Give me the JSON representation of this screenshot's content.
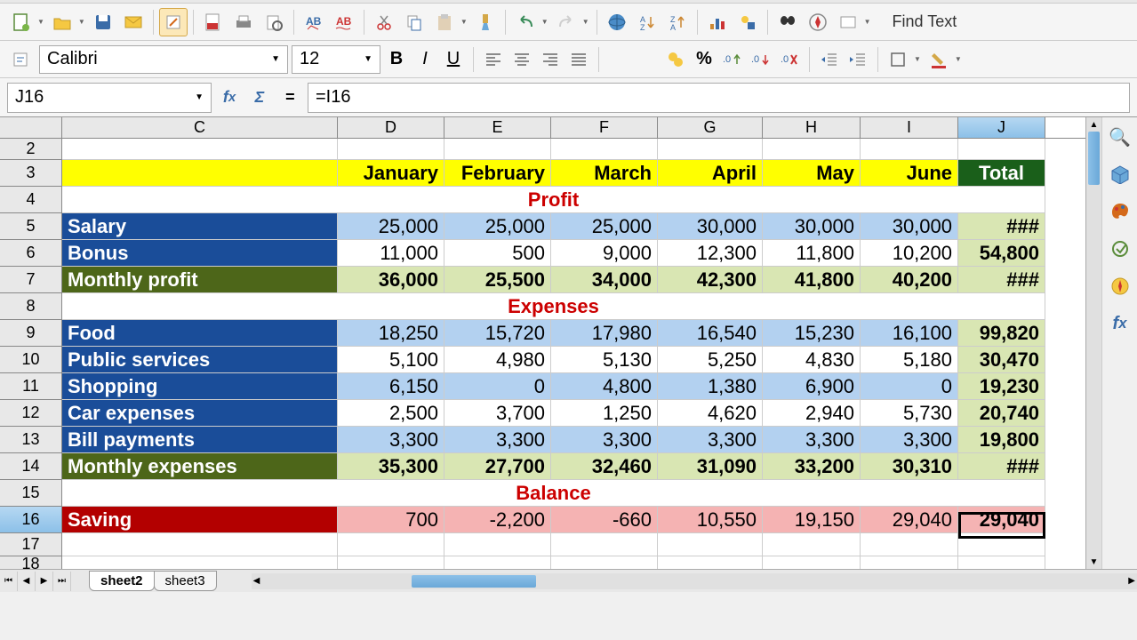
{
  "toolbar": {
    "find_label": "Find Text"
  },
  "format": {
    "font": "Calibri",
    "size": "12"
  },
  "formula": {
    "cell_ref": "J16",
    "value": "=I16"
  },
  "columns": [
    "C",
    "D",
    "E",
    "F",
    "G",
    "H",
    "I",
    "J"
  ],
  "col_widths": {
    "C": 310,
    "D": 120,
    "E": 120,
    "F": 120,
    "G": 118,
    "H": 110,
    "I": 110,
    "J": 98
  },
  "rows_visible": [
    2,
    3,
    4,
    5,
    6,
    7,
    8,
    9,
    10,
    11,
    12,
    13,
    14,
    15,
    16,
    17,
    18
  ],
  "header_row": {
    "months": [
      "January",
      "February",
      "March",
      "April",
      "May",
      "June"
    ],
    "total": "Total"
  },
  "sections": {
    "profit": "Profit",
    "expenses": "Expenses",
    "balance": "Balance"
  },
  "data": {
    "salary": {
      "label": "Salary",
      "vals": [
        "25,000",
        "25,000",
        "25,000",
        "30,000",
        "30,000",
        "30,000"
      ],
      "total": "###"
    },
    "bonus": {
      "label": "Bonus",
      "vals": [
        "11,000",
        "500",
        "9,000",
        "12,300",
        "11,800",
        "10,200"
      ],
      "total": "54,800"
    },
    "monthly_profit": {
      "label": "Monthly profit",
      "vals": [
        "36,000",
        "25,500",
        "34,000",
        "42,300",
        "41,800",
        "40,200"
      ],
      "total": "###"
    },
    "food": {
      "label": "Food",
      "vals": [
        "18,250",
        "15,720",
        "17,980",
        "16,540",
        "15,230",
        "16,100"
      ],
      "total": "99,820"
    },
    "public_services": {
      "label": "Public services",
      "vals": [
        "5,100",
        "4,980",
        "5,130",
        "5,250",
        "4,830",
        "5,180"
      ],
      "total": "30,470"
    },
    "shopping": {
      "label": "Shopping",
      "vals": [
        "6,150",
        "0",
        "4,800",
        "1,380",
        "6,900",
        "0"
      ],
      "total": "19,230"
    },
    "car_expenses": {
      "label": "Car expenses",
      "vals": [
        "2,500",
        "3,700",
        "1,250",
        "4,620",
        "2,940",
        "5,730"
      ],
      "total": "20,740"
    },
    "bill_payments": {
      "label": "Bill payments",
      "vals": [
        "3,300",
        "3,300",
        "3,300",
        "3,300",
        "3,300",
        "3,300"
      ],
      "total": "19,800"
    },
    "monthly_expenses": {
      "label": "Monthly expenses",
      "vals": [
        "35,300",
        "27,700",
        "32,460",
        "31,090",
        "33,200",
        "30,310"
      ],
      "total": "###"
    },
    "saving": {
      "label": "Saving",
      "vals": [
        "700",
        "-2,200",
        "-660",
        "10,550",
        "19,150",
        "29,040"
      ],
      "total": "29,040"
    }
  },
  "tabs": [
    "sheet2",
    "sheet3"
  ],
  "selected_cell": "J16"
}
